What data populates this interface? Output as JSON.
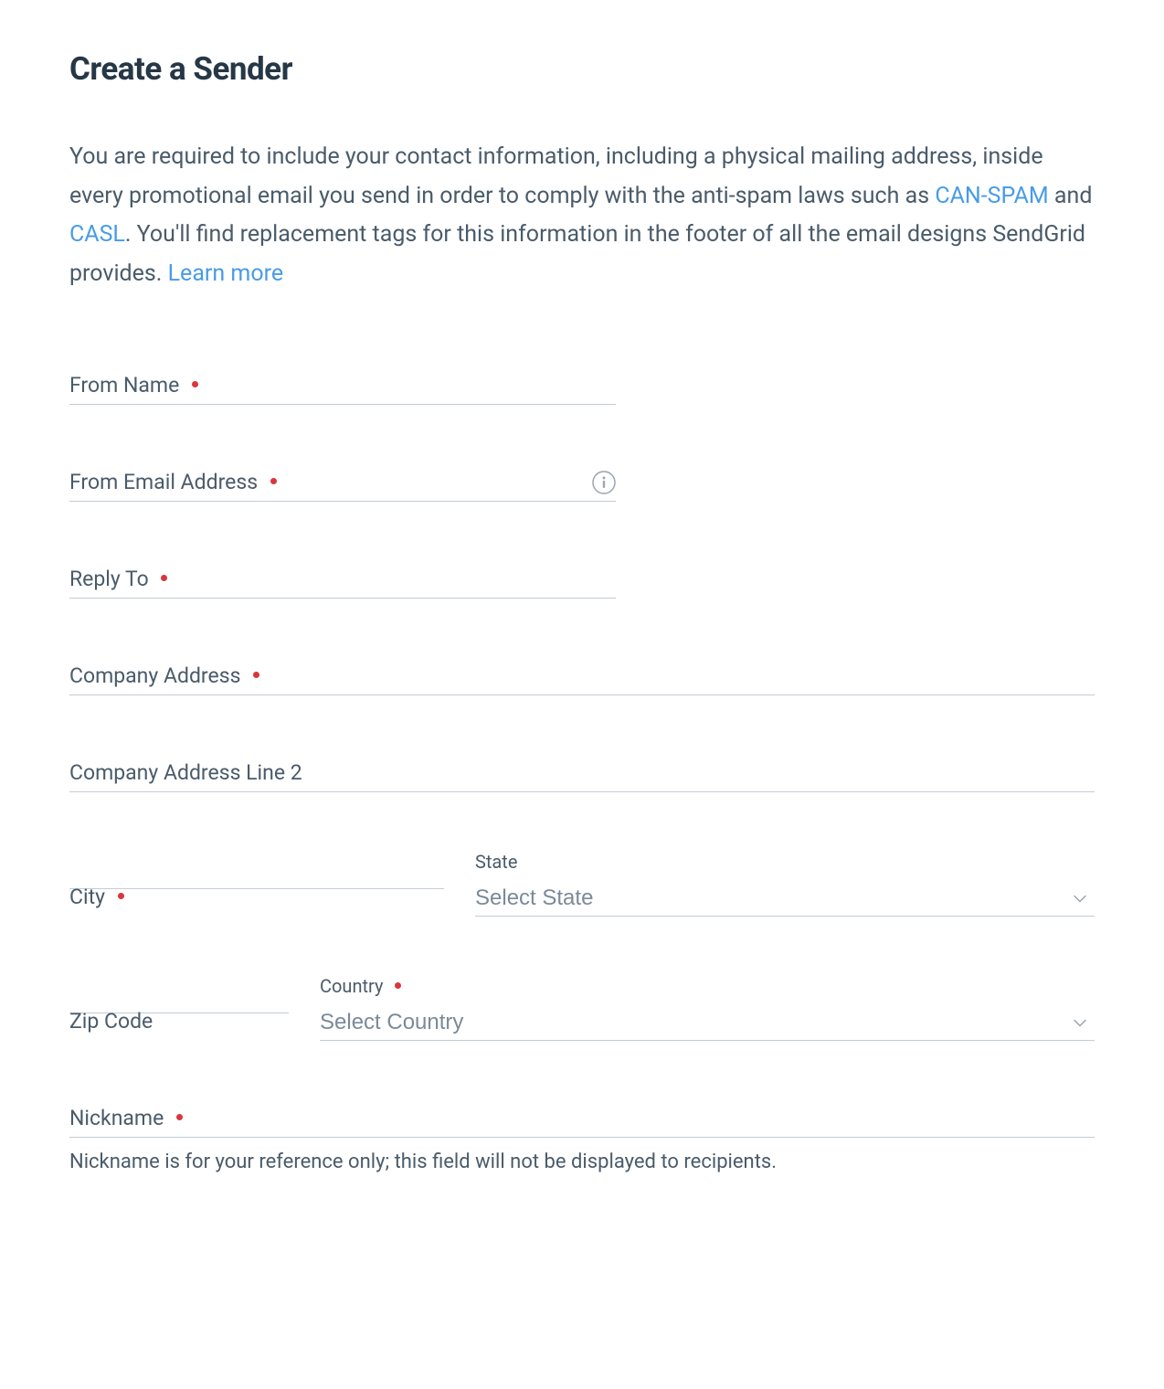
{
  "page": {
    "title": "Create a Sender",
    "description_part1": "You are required to include your contact information, including a physical mailing address, inside every promotional email you send in order to comply with the anti-spam laws such as ",
    "link_canspam": "CAN-SPAM",
    "description_part2": " and ",
    "link_casl": "CASL",
    "description_part3": ". You'll find replacement tags for this information in the footer of all the email designs SendGrid provides. ",
    "link_learnmore": "Learn more"
  },
  "form": {
    "from_name": {
      "label": "From Name",
      "value": ""
    },
    "from_email": {
      "label": "From Email Address",
      "value": ""
    },
    "reply_to": {
      "label": "Reply To",
      "value": ""
    },
    "company_address": {
      "label": "Company Address",
      "value": ""
    },
    "company_address2": {
      "label": "Company Address Line 2",
      "value": ""
    },
    "city": {
      "label": "City",
      "value": ""
    },
    "state": {
      "label": "State",
      "placeholder": "Select State"
    },
    "zip": {
      "label": "Zip Code",
      "value": ""
    },
    "country": {
      "label": "Country",
      "placeholder": "Select Country"
    },
    "nickname": {
      "label": "Nickname",
      "value": "",
      "helper": "Nickname is for your reference only; this field will not be displayed to recipients."
    }
  }
}
